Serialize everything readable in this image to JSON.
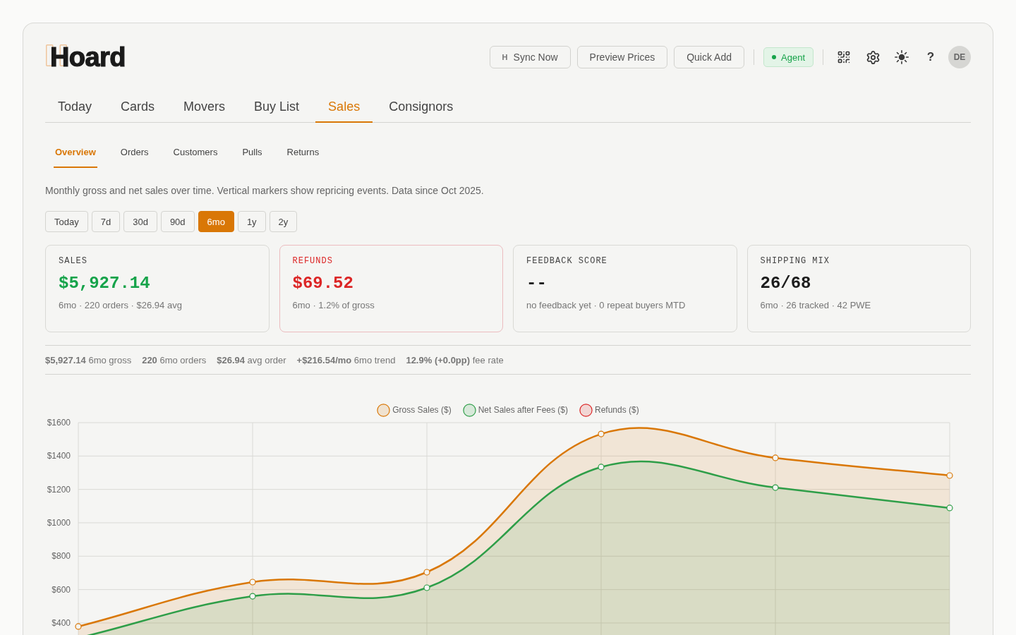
{
  "logo": {
    "name": "Hoard"
  },
  "header_buttons": [
    {
      "icon": "H",
      "label": "Sync Now"
    },
    {
      "label": "Preview Prices"
    },
    {
      "label": "Quick Add"
    }
  ],
  "agent_badge": {
    "label": "Agent",
    "online": true
  },
  "help_button": {
    "label": "?"
  },
  "avatar": {
    "initials": "DE"
  },
  "tabs": [
    {
      "label": "Today",
      "selected": false
    },
    {
      "label": "Cards",
      "selected": false
    },
    {
      "label": "Movers",
      "selected": false
    },
    {
      "label": "Buy List",
      "selected": false
    },
    {
      "label": "Sales",
      "selected": true
    },
    {
      "label": "Consignors",
      "selected": false
    }
  ],
  "subtabs": [
    {
      "label": "Overview",
      "selected": true
    },
    {
      "label": "Orders",
      "selected": false
    },
    {
      "label": "Customers",
      "selected": false
    },
    {
      "label": "Pulls",
      "selected": false
    },
    {
      "label": "Returns",
      "selected": false
    }
  ],
  "description": "Monthly gross and net sales over time. Vertical markers show repricing events. Data since Oct 2025.",
  "ranges": [
    {
      "label": "Today",
      "selected": false
    },
    {
      "label": "7d",
      "selected": false
    },
    {
      "label": "30d",
      "selected": false
    },
    {
      "label": "90d",
      "selected": false
    },
    {
      "label": "6mo",
      "selected": true
    },
    {
      "label": "1y",
      "selected": false
    },
    {
      "label": "2y",
      "selected": false
    }
  ],
  "cards": [
    {
      "kind": "positive",
      "label": "SALES",
      "value": "$5,927.14",
      "note": "6mo · 220 orders · $26.94 avg"
    },
    {
      "kind": "negative",
      "label": "REFUNDS",
      "value": "$69.52",
      "note": "6mo · 1.2% of gross"
    },
    {
      "kind": "plain",
      "label": "FEEDBACK SCORE",
      "value": "--",
      "note": "no feedback yet · 0 repeat buyers MTD"
    },
    {
      "kind": "plain",
      "label": "SHIPPING MIX",
      "value": "26/68",
      "note": "6mo · 26 tracked · 42 PWE"
    }
  ],
  "summary": [
    "**$5,927.14** 6mo gross",
    "**220** 6mo orders",
    "**$26.94** avg order",
    "**+$216.54/mo** 6mo trend",
    "**12.9% (+0.0pp)** fee rate"
  ],
  "chart": {
    "chart_data": {
      "type": "area",
      "ylim": [
        0,
        1600
      ],
      "yticks": [
        {
          "value": 400,
          "label": "$400"
        },
        {
          "value": 600,
          "label": "$600"
        },
        {
          "value": 800,
          "label": "$800"
        },
        {
          "value": 1000,
          "label": "$1000"
        },
        {
          "value": 1200,
          "label": "$1200"
        },
        {
          "value": 1400,
          "label": "$1400"
        },
        {
          "value": 1600,
          "label": "$1600"
        }
      ],
      "grid": true,
      "legend": "top",
      "series": [
        {
          "name": "Gross Sales ($)",
          "color": "#d97706",
          "values": [
            379,
            645,
            704,
            1532,
            1389,
            1283
          ]
        },
        {
          "name": "Net Sales after Fees ($)",
          "color": "#2e9e48",
          "values": [
            310,
            560,
            611,
            1334,
            1211,
            1089
          ]
        },
        {
          "name": "Refunds ($)",
          "color": "#dc2626"
        }
      ]
    }
  }
}
